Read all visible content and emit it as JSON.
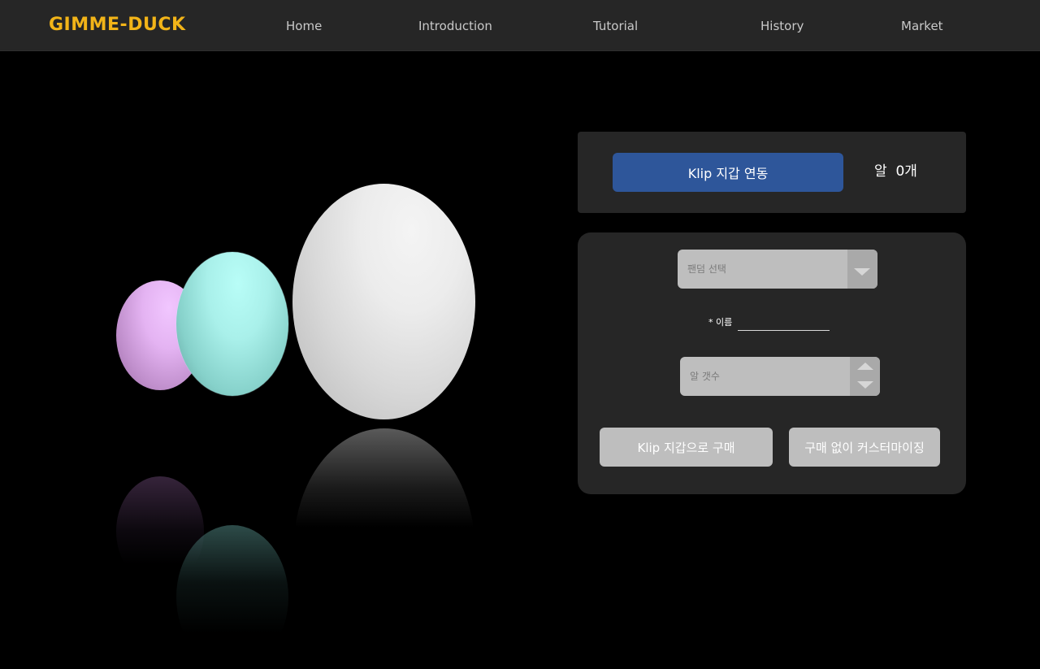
{
  "header": {
    "logo": "GIMME-DUCK",
    "nav": [
      "Home",
      "Introduction",
      "Tutorial",
      "History",
      "Market"
    ]
  },
  "wallet": {
    "connect_label": "Klip 지갑 연동",
    "egg_count": "알  0개"
  },
  "form": {
    "select": {
      "placeholder": "팬덤 선택"
    },
    "name_label": "* 이름",
    "name_value": "",
    "quantity": {
      "placeholder": "알 갯수"
    },
    "buy_label": "Klip 지갑으로 구매",
    "customize_label": "구매 없이 커스터마이징"
  },
  "icons": {
    "select_arrow": "chevron-down-icon",
    "stepper_up": "chevron-up-icon",
    "stepper_down": "chevron-down-icon"
  },
  "colors": {
    "logo": "#f2b418",
    "header_bg": "#262626",
    "page_bg": "#000000",
    "panel_bg": "#262626",
    "klip_button": "#2e569a",
    "form_control": "#bebebe",
    "egg_pink": "#e4b3f2",
    "egg_cyan": "#a9f0ea",
    "egg_white": "#ececec"
  }
}
